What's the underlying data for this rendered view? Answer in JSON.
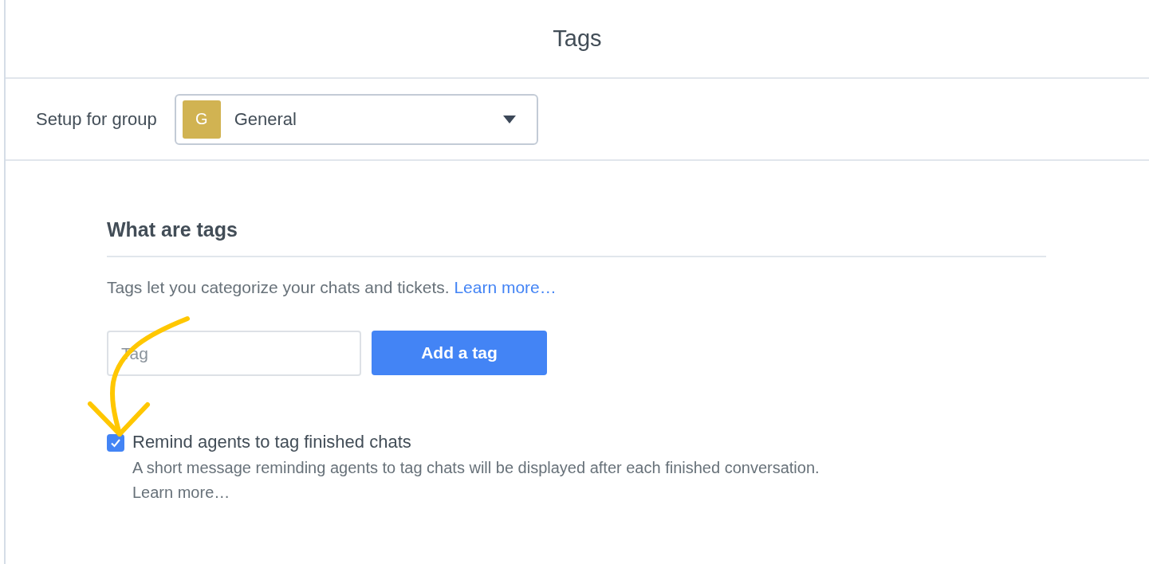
{
  "page_title": "Tags",
  "group_setup": {
    "label": "Setup for group",
    "avatar_letter": "G",
    "value": "General"
  },
  "section": {
    "heading": "What are tags",
    "description": "Tags let you categorize your chats and tickets.",
    "link": "Learn more…"
  },
  "tag_input": {
    "placeholder": "Tag"
  },
  "add_button": "Add a tag",
  "reminder": {
    "checked": true,
    "label": "Remind agents to tag finished chats",
    "description": "A short message reminding agents to tag chats will be displayed after each finished conversation.",
    "link": "Learn more…"
  }
}
